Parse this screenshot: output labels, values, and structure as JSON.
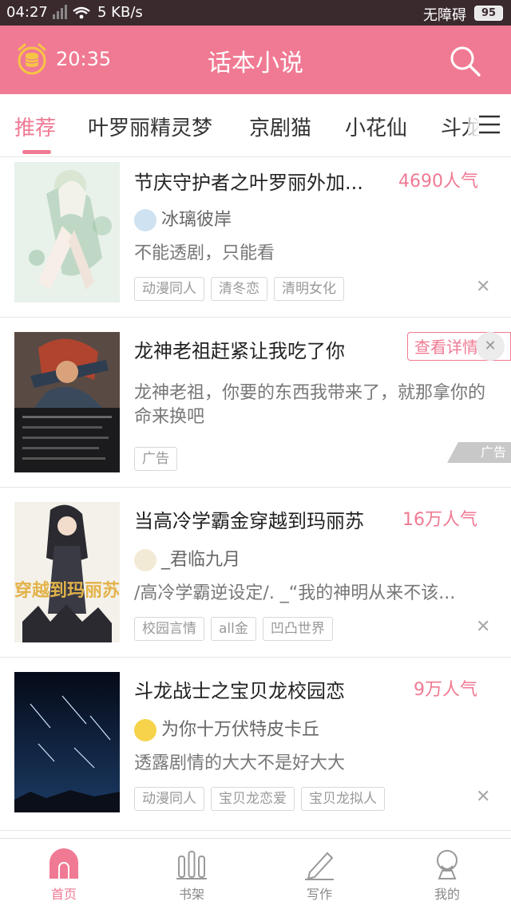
{
  "status_bar": {
    "time": "04:27",
    "network": "5 KB/s",
    "accessibility": "无障碍",
    "battery": "95"
  },
  "header": {
    "clock": "20:35",
    "title": "话本小说"
  },
  "tabs": [
    {
      "label": "推荐",
      "active": true
    },
    {
      "label": "叶罗丽精灵梦"
    },
    {
      "label": "京剧猫"
    },
    {
      "label": "小花仙"
    },
    {
      "label": "斗龙"
    }
  ],
  "cards": [
    {
      "title": "节庆守护者之叶罗丽外加...",
      "popularity": "4690人气",
      "author": "冰璃彼岸",
      "desc": "不能透剧，只能看",
      "tags": [
        "动漫同人",
        "清冬恋",
        "清明女化"
      ]
    },
    {
      "title": "当高冷学霸金穿越到玛丽苏",
      "popularity": "16万人气",
      "author": "_君临九月",
      "desc": "/高冷学霸逆设定/.  _“我的神明从来不该...",
      "tags": [
        "校园言情",
        "all金",
        "凹凸世界"
      ]
    },
    {
      "title": "斗龙战士之宝贝龙校园恋",
      "popularity": "9万人气",
      "author": "为你十万伏特皮卡丘",
      "desc": "透露剧情的大大不是好大大",
      "tags": [
        "动漫同人",
        "宝贝龙恋爱",
        "宝贝龙拟人"
      ]
    }
  ],
  "ad": {
    "title": "龙神老祖赶紧让我吃了你",
    "button": "查看详情",
    "desc": "龙神老祖，你要的东西我带来了，就那拿你的命来换吧",
    "tag": "广告",
    "label": "广告"
  },
  "cover_art_text": {
    "cover2": "穿越到玛丽苏"
  },
  "bottom_nav": [
    {
      "label": "首页",
      "active": true
    },
    {
      "label": "书架"
    },
    {
      "label": "写作"
    },
    {
      "label": "我的"
    }
  ],
  "colors": {
    "accent": "#f07a93",
    "status_bar": "#3a2a2e"
  }
}
